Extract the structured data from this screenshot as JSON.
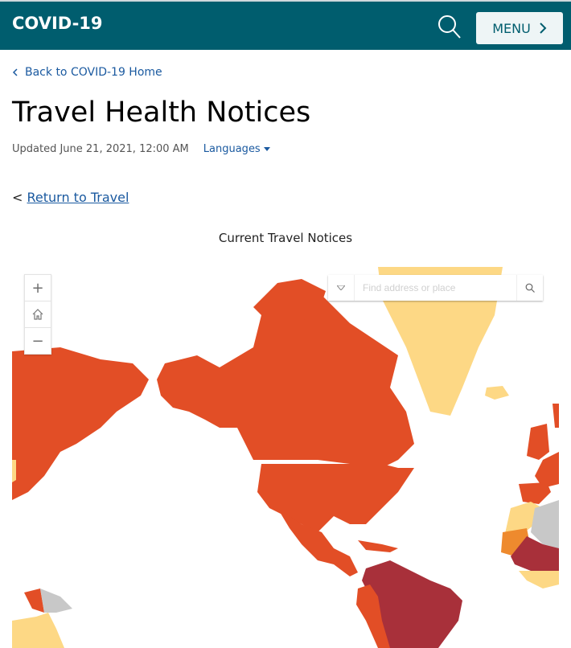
{
  "header": {
    "brand": "COVID-19",
    "menu_label": "MENU",
    "icons": {
      "search": "search-icon",
      "menu_chevron": "chevron-right-icon"
    }
  },
  "nav": {
    "back_link": "Back to COVID-19 Home",
    "return_prefix": "<",
    "return_link": "Return to Travel"
  },
  "page": {
    "title": "Travel Health Notices",
    "updated": "Updated June 21, 2021, 12:00 AM",
    "languages_label": "Languages"
  },
  "map": {
    "title": "Current Travel Notices",
    "search_placeholder": "Find address or place",
    "controls": {
      "zoom_in": "+",
      "home": "home-icon",
      "zoom_out": "−"
    },
    "legend_colors": {
      "level4": "#a8303a",
      "level3": "#e24e26",
      "level2": "#ee8a2e",
      "level1": "#fdd885",
      "unknown": "#c8c8c8"
    }
  }
}
